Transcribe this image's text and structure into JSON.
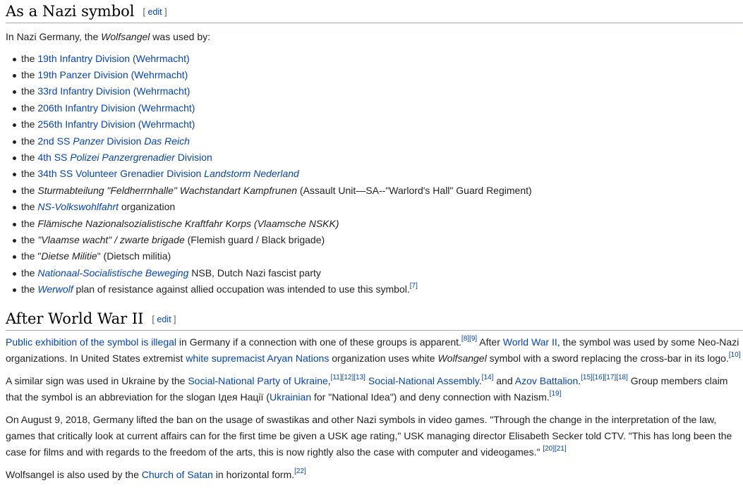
{
  "section1": {
    "heading": "As a Nazi symbol",
    "edit_bracket_open": "[",
    "edit_label": "edit",
    "edit_bracket_close": "]",
    "intro_pre": "In Nazi Germany, the ",
    "intro_italic": "Wolfsangel",
    "intro_post": " was used by:",
    "items": [
      {
        "segments": [
          {
            "t": "the "
          },
          {
            "t": "19th Infantry Division (Wehrmacht)",
            "link": true
          }
        ]
      },
      {
        "segments": [
          {
            "t": "the "
          },
          {
            "t": "19th Panzer Division (Wehrmacht)",
            "link": true
          }
        ]
      },
      {
        "segments": [
          {
            "t": "the "
          },
          {
            "t": "33rd Infantry Division (Wehrmacht)",
            "link": true
          }
        ]
      },
      {
        "segments": [
          {
            "t": "the "
          },
          {
            "t": "206th Infantry Division (Wehrmacht)",
            "link": true
          }
        ]
      },
      {
        "segments": [
          {
            "t": "the "
          },
          {
            "t": "256th Infantry Division (Wehrmacht)",
            "link": true
          }
        ]
      },
      {
        "segments": [
          {
            "t": "the "
          },
          {
            "t": "2nd SS ",
            "link": true
          },
          {
            "t": "Panzer",
            "link": true,
            "italic": true
          },
          {
            "t": " Division ",
            "link": true
          },
          {
            "t": "Das Reich",
            "link": true,
            "italic": true
          }
        ]
      },
      {
        "segments": [
          {
            "t": "the "
          },
          {
            "t": "4th SS ",
            "link": true
          },
          {
            "t": "Polizei Panzergrenadier",
            "link": true,
            "italic": true
          },
          {
            "t": " Division",
            "link": true
          }
        ]
      },
      {
        "segments": [
          {
            "t": "the "
          },
          {
            "t": "34th SS Volunteer Grenadier Division ",
            "link": true
          },
          {
            "t": "Landstorm Nederland",
            "link": true,
            "italic": true
          }
        ]
      },
      {
        "segments": [
          {
            "t": "the "
          },
          {
            "t": "Sturmabteilung \"Feldherrnhalle\" Wachstandart Kampfrunen",
            "italic": true
          },
          {
            "t": " (Assault Unit—SA--\"Warlord's Hall\" Guard Regiment)"
          }
        ]
      },
      {
        "segments": [
          {
            "t": "the "
          },
          {
            "t": "NS-Volkswohlfahrt",
            "link": true,
            "italic": true
          },
          {
            "t": " organization"
          }
        ]
      },
      {
        "segments": [
          {
            "t": "the "
          },
          {
            "t": "Flämische Nazionalsozialistische Kraftfahr Korps (Vlaamsche NSKK)",
            "italic": true
          }
        ]
      },
      {
        "segments": [
          {
            "t": "the "
          },
          {
            "t": "\"Vlaamse wacht\" / zwarte brigade",
            "italic": true
          },
          {
            "t": " (Flemish guard / Black brigade)"
          }
        ]
      },
      {
        "segments": [
          {
            "t": "the \""
          },
          {
            "t": "Dietse Militie",
            "italic": true
          },
          {
            "t": "\" (Dietsch militia)"
          }
        ]
      },
      {
        "segments": [
          {
            "t": "the "
          },
          {
            "t": "Nationaal-Socialistische Beweging",
            "link": true,
            "italic": true
          },
          {
            "t": " NSB, Dutch Nazi fascist party"
          }
        ]
      },
      {
        "segments": [
          {
            "t": "the "
          },
          {
            "t": "Werwolf",
            "link": true,
            "italic": true
          },
          {
            "t": " plan of resistance against allied occupation was intended to use this symbol."
          },
          {
            "t": "[7]",
            "link": true,
            "sup": true
          }
        ]
      }
    ]
  },
  "section2": {
    "heading": "After World War II",
    "edit_bracket_open": "[",
    "edit_label": "edit",
    "edit_bracket_close": "]",
    "paragraphs": [
      [
        {
          "t": "Public exhibition of the symbol is illegal",
          "link": true
        },
        {
          "t": " in Germany if a connection with one of these groups is apparent."
        },
        {
          "t": "[8]",
          "link": true,
          "sup": true
        },
        {
          "t": "[9]",
          "link": true,
          "sup": true
        },
        {
          "t": " After "
        },
        {
          "t": "World War II",
          "link": true
        },
        {
          "t": ", the symbol was used by some Neo-Nazi organizations. In United States extremist "
        },
        {
          "t": "white supremacist",
          "link": true
        },
        {
          "t": " "
        },
        {
          "t": "Aryan Nations",
          "link": true
        },
        {
          "t": " organization uses white "
        },
        {
          "t": "Wolfsangel",
          "italic": true
        },
        {
          "t": " symbol with a sword replacing the cross-bar in its logo."
        },
        {
          "t": "[10]",
          "link": true,
          "sup": true
        }
      ],
      [
        {
          "t": "A similar sign was used in Ukraine by the "
        },
        {
          "t": "Social-National Party of Ukraine",
          "link": true
        },
        {
          "t": ","
        },
        {
          "t": "[11]",
          "link": true,
          "sup": true
        },
        {
          "t": "[12]",
          "link": true,
          "sup": true
        },
        {
          "t": "[13]",
          "link": true,
          "sup": true
        },
        {
          "t": " "
        },
        {
          "t": "Social-National Assembly",
          "link": true
        },
        {
          "t": "."
        },
        {
          "t": "[14]",
          "link": true,
          "sup": true
        },
        {
          "t": " and "
        },
        {
          "t": "Azov Battalion",
          "link": true
        },
        {
          "t": "."
        },
        {
          "t": "[15]",
          "link": true,
          "sup": true
        },
        {
          "t": "[16]",
          "link": true,
          "sup": true
        },
        {
          "t": "[17]",
          "link": true,
          "sup": true
        },
        {
          "t": "[18]",
          "link": true,
          "sup": true
        },
        {
          "t": " Group members claim that the symbol is an abbreviation for the slogan Ідея Нації ("
        },
        {
          "t": "Ukrainian",
          "link": true
        },
        {
          "t": " for \"National Idea\") and deny connection with Nazism."
        },
        {
          "t": "[19]",
          "link": true,
          "sup": true
        }
      ],
      [
        {
          "t": "On August 9, 2018, Germany lifted the ban on the usage of swastikas and other Nazi symbols in video games. \"Through the change in the interpretation of the law, games that critically look at current affairs can for the first time be given a USK age rating,\" USK managing director Elisabeth Secker told CTV. \"This has long been the case for films and with regards to the freedom of the arts, this is now rightly also the case with computer and videogames.\" "
        },
        {
          "t": "[20]",
          "link": true,
          "sup": true
        },
        {
          "t": "[21]",
          "link": true,
          "sup": true
        }
      ],
      [
        {
          "t": "Wolfsangel is also used by the "
        },
        {
          "t": "Church of Satan",
          "link": true
        },
        {
          "t": " in horizontal form."
        },
        {
          "t": "[22]",
          "link": true,
          "sup": true
        }
      ]
    ]
  }
}
